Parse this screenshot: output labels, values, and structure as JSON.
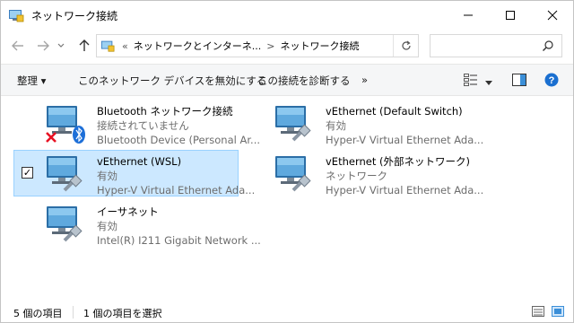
{
  "window": {
    "title": "ネットワーク接続",
    "controls": {
      "minimize": "—",
      "maximize": "☐",
      "close": "✕"
    }
  },
  "nav": {
    "back_icon": "arrow-left-icon",
    "forward_icon": "arrow-right-icon",
    "recent_icon": "chevron-down-icon",
    "up_icon": "arrow-up-icon",
    "breadcrumb": {
      "overflow": "«",
      "parent": "ネットワークとインターネ...",
      "separator": ">",
      "current": "ネットワーク接続"
    },
    "refresh_icon": "refresh-icon",
    "search_placeholder": ""
  },
  "commands": {
    "organize": "整理 ▾",
    "disable": "このネットワーク デバイスを無効にする",
    "diagnose": "この接続を診断する",
    "more": "»"
  },
  "connections": [
    {
      "name": "Bluetooth ネットワーク接続",
      "status": "接続されていません",
      "device": "Bluetooth Device (Personal Ar...",
      "selected": false,
      "icon": "bluetooth-network-icon"
    },
    {
      "name": "vEthernet (Default Switch)",
      "status": "有効",
      "device": "Hyper-V Virtual Ethernet Ada...",
      "selected": false,
      "icon": "ethernet-network-icon"
    },
    {
      "name": "vEthernet (WSL)",
      "status": "有効",
      "device": "Hyper-V Virtual Ethernet Ada...",
      "selected": true,
      "icon": "ethernet-network-icon"
    },
    {
      "name": "vEthernet (外部ネットワーク)",
      "status": "ネットワーク",
      "device": "Hyper-V Virtual Ethernet Ada...",
      "selected": false,
      "icon": "ethernet-network-icon"
    },
    {
      "name": "イーサネット",
      "status": "有効",
      "device": "Intel(R) I211 Gigabit Network ...",
      "selected": false,
      "icon": "ethernet-network-icon"
    }
  ],
  "status": {
    "count": "5 個の項目",
    "selected": "1 個の項目を選択"
  },
  "colors": {
    "selection_bg": "#cce8ff",
    "selection_border": "#99d1ff",
    "accent": "#0078d7",
    "disconnected_x": "#e81123",
    "bluetooth": "#1d6fd8"
  }
}
